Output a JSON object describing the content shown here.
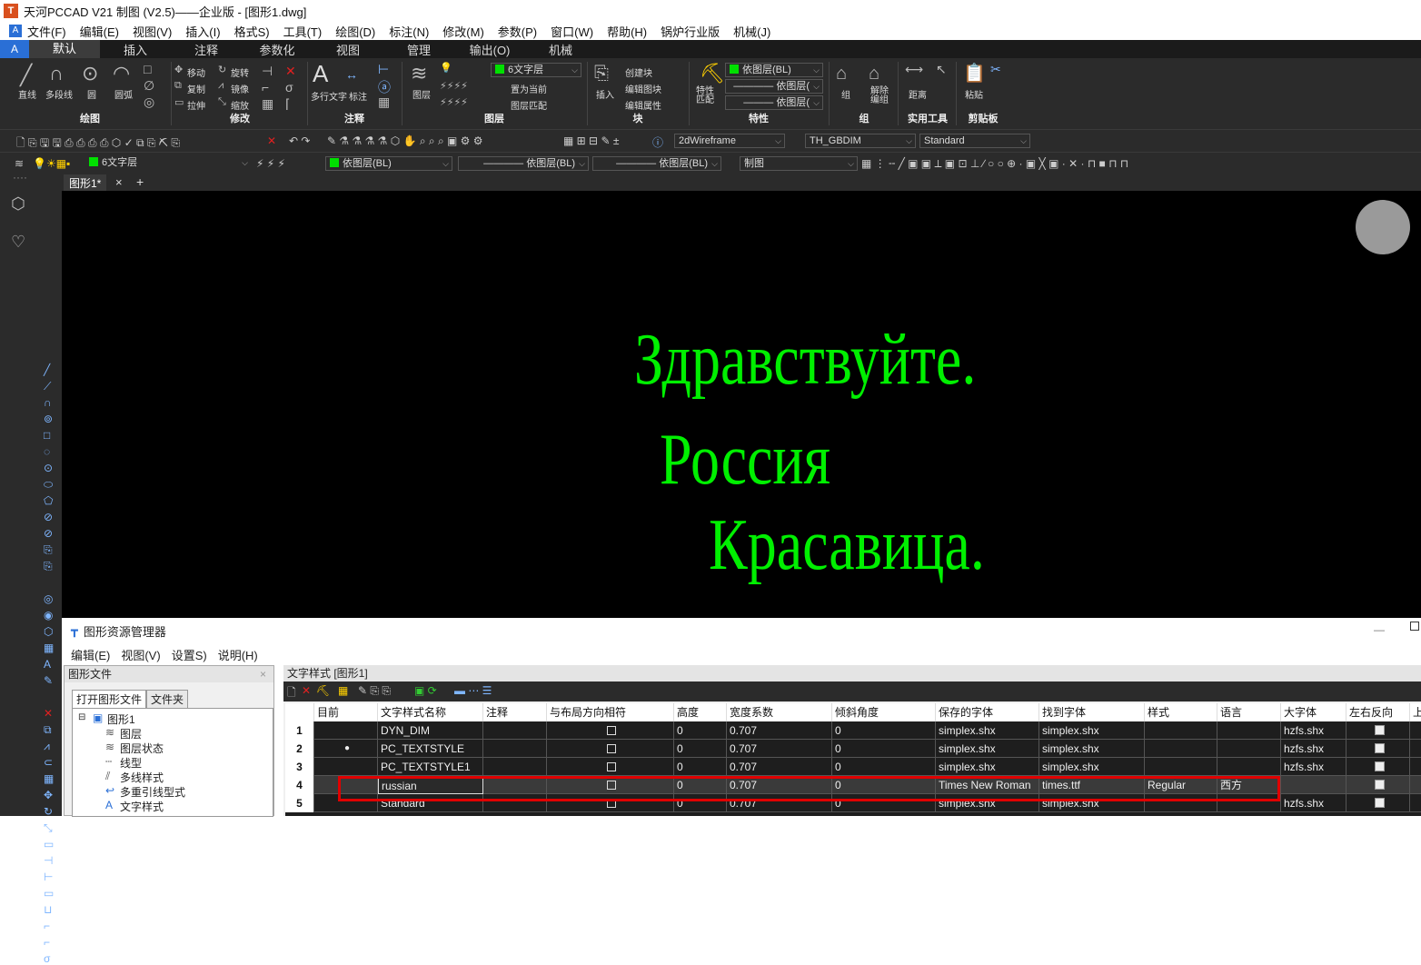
{
  "window": {
    "title": "天河PCCAD V21 制图 (V2.5)——企业版 - [图形1.dwg]",
    "app_icon": "T"
  },
  "menubar": {
    "logo": "A",
    "items": [
      "文件(F)",
      "编辑(E)",
      "视图(V)",
      "插入(I)",
      "格式S)",
      "工具(T)",
      "绘图(D)",
      "标注(N)",
      "修改(M)",
      "参数(P)",
      "窗口(W)",
      "帮助(H)",
      "锅炉行业版",
      "机械(J)"
    ]
  },
  "ribbon_tabs": {
    "logo": "A",
    "tabs": [
      "默认",
      "插入",
      "注释",
      "参数化",
      "视图",
      "管理",
      "输出(O)",
      "机械"
    ],
    "active": "默认"
  },
  "ribbon": {
    "draw": {
      "label": "绘图",
      "tools": [
        "直线",
        "多段线",
        "圆",
        "圆弧"
      ]
    },
    "modify": {
      "label": "修改",
      "tools": [
        "移动",
        "旋转",
        "复制",
        "镜像",
        "拉伸",
        "缩放"
      ]
    },
    "annotate": {
      "label": "注释",
      "tools": [
        "多行文字",
        "标注"
      ]
    },
    "layers": {
      "label": "图层",
      "tool": "图层",
      "current": "6文字层",
      "set_current": "置为当前",
      "match": "图层匹配"
    },
    "block": {
      "label": "块",
      "insert": "插入",
      "create": "创建块",
      "edit": "编辑图块",
      "attr": "编辑属性"
    },
    "properties": {
      "label": "特性",
      "match": "特性匹配",
      "color": "依图层(BL)",
      "linetype": "依图层(",
      "lineweight": "依图层("
    },
    "group": {
      "label": "组",
      "group": "组",
      "ungroup": "解除编组"
    },
    "utilities": {
      "label": "实用工具",
      "measure": "距离"
    },
    "clipboard": {
      "label": "剪贴板",
      "paste": "粘贴"
    }
  },
  "toolbar1": {
    "visual_style": "2dWireframe",
    "dim_style": "TH_GBDIM",
    "text_style": "Standard"
  },
  "toolbar2": {
    "layer": "6文字层",
    "color": "依图层(BL)",
    "linetype": "依图层(BL)",
    "lineweight": "依图层(BL)",
    "plot_style": "制图"
  },
  "doc_tab": {
    "name": "图形1*",
    "close": "×",
    "add": "+"
  },
  "canvas": {
    "lines": [
      "Здравствуйте.",
      "Россия",
      "Красавица."
    ],
    "text_color": "#00f000"
  },
  "manager": {
    "title": "图形资源管理器",
    "menu": [
      "编辑(E)",
      "视图(V)",
      "设置S)",
      "说明(H)"
    ],
    "left_panel": {
      "title": "图形文件",
      "tabs": [
        "打开图形文件",
        "文件夹"
      ],
      "tree": {
        "root": "图形1",
        "children": [
          "图层",
          "图层状态",
          "线型",
          "多线样式",
          "多重引线型式",
          "文字样式"
        ]
      }
    },
    "right_panel": {
      "title": "文字样式 [图形1]",
      "columns": [
        "",
        "目前",
        "文字样式名称",
        "注释",
        "与布局方向相符",
        "高度",
        "宽度系数",
        "倾斜角度",
        "保存的字体",
        "找到字体",
        "样式",
        "语言",
        "大字体",
        "左右反向",
        "上"
      ],
      "rows": [
        {
          "n": "1",
          "current": "",
          "name": "DYN_DIM",
          "height": "0",
          "width": "0.707",
          "oblique": "0",
          "saved_font": "simplex.shx",
          "found_font": "simplex.shx",
          "style": "",
          "lang": "",
          "bigfont": "hzfs.shx",
          "backwards": true
        },
        {
          "n": "2",
          "current": "●",
          "name": "PC_TEXTSTYLE",
          "height": "0",
          "width": "0.707",
          "oblique": "0",
          "saved_font": "simplex.shx",
          "found_font": "simplex.shx",
          "style": "",
          "lang": "",
          "bigfont": "hzfs.shx",
          "backwards": true
        },
        {
          "n": "3",
          "current": "",
          "name": "PC_TEXTSTYLE1",
          "height": "0",
          "width": "0.707",
          "oblique": "0",
          "saved_font": "simplex.shx",
          "found_font": "simplex.shx",
          "style": "",
          "lang": "",
          "bigfont": "hzfs.shx",
          "backwards": true
        },
        {
          "n": "4",
          "current": "",
          "name": "russian",
          "height": "0",
          "width": "0.707",
          "oblique": "0",
          "saved_font": "Times New Roman",
          "found_font": "times.ttf",
          "style": "Regular",
          "lang": "西方",
          "bigfont": "",
          "backwards": true
        },
        {
          "n": "5",
          "current": "",
          "name": "Standard",
          "height": "0",
          "width": "0.707",
          "oblique": "0",
          "saved_font": "simplex.shx",
          "found_font": "simplex.shx",
          "style": "",
          "lang": "",
          "bigfont": "hzfs.shx",
          "backwards": true
        }
      ],
      "selected_row": "4",
      "highlight_color": "#e00000"
    }
  }
}
